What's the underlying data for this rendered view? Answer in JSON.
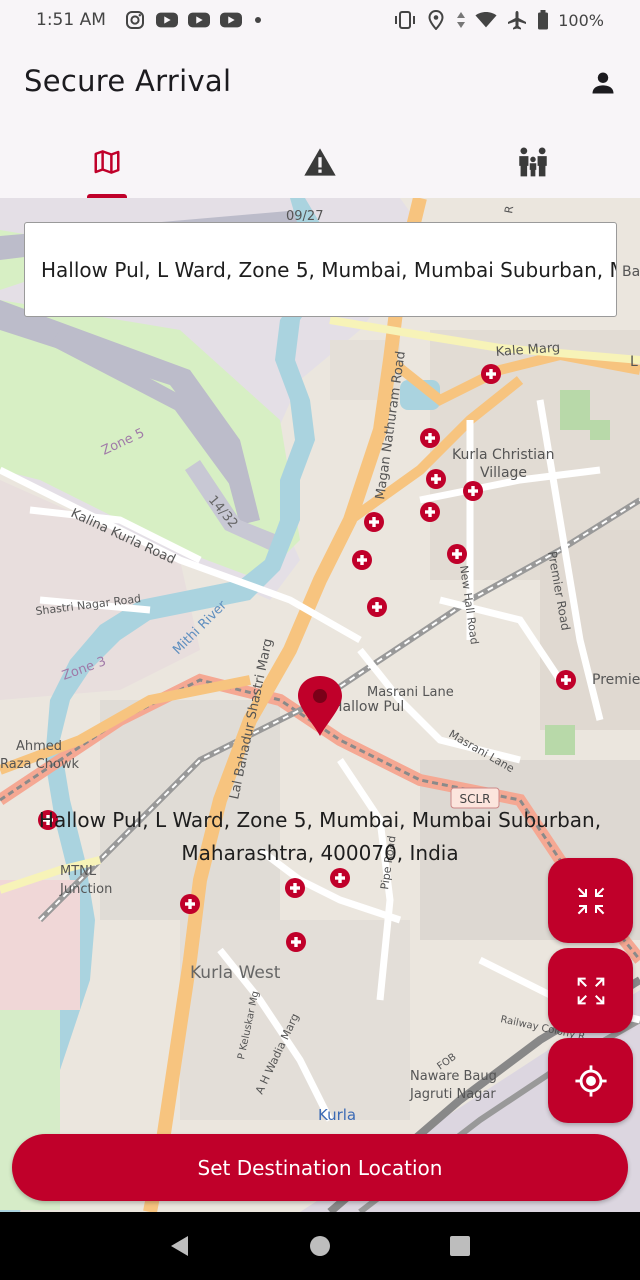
{
  "status_bar": {
    "time": "1:51 AM",
    "left_icons": [
      "instagram-icon",
      "youtube-icon",
      "youtube-icon",
      "youtube-icon",
      "dot-icon"
    ],
    "right_icons": [
      "vibrate-icon",
      "location-icon",
      "data-arrows-icon",
      "wifi-icon",
      "airplane-icon",
      "battery-icon"
    ],
    "battery": "100%"
  },
  "app_bar": {
    "title": "Secure Arrival",
    "profile_icon": "person-icon"
  },
  "tabs": [
    {
      "icon": "map-icon",
      "selected": true
    },
    {
      "icon": "warning-icon",
      "selected": false
    },
    {
      "icon": "family-icon",
      "selected": false
    }
  ],
  "search": {
    "value": "Hallow Pul, L Ward, Zone 5, Mumbai, Mumbai Suburban, Maharashtra, 400070, India"
  },
  "map": {
    "labels": {
      "road_0927": "09/27",
      "kale_marg": "Kale Marg",
      "magan_nathuram_road": "Magan Nathuram Road",
      "kurla_christian_village_1": "Kurla Christian",
      "kurla_christian_village_2": "Village",
      "zone5": "Zone 5",
      "runway_1432": "14/32",
      "kalina_kurla_road": "Kalina Kurla Road",
      "shastri_nagar_road": "Shastri Nagar Road",
      "mithi_river": "Mithi River",
      "zone3": "Zone 3",
      "new_hall_road": "New Hall Road",
      "premier_road": "Premier Road",
      "premier": "Premie",
      "masrani_lane": "Masrani Lane",
      "masrani_lane_2": "Masrani Lane",
      "hallow_pul": "Hallow Pul",
      "ahmed_raza_chowk_1": "Ahmed",
      "ahmed_raza_chowk_2": "Raza Chowk",
      "lbs_marg": "Lal Bahadur Shastri Marg",
      "sclr": "SCLR",
      "mtnl_junction_1": "MTNL",
      "mtnl_junction_2": "Junction",
      "pipe_road": "Pipe Road",
      "kurla_west": "Kurla West",
      "keluskar_marg": "P Keluskar Mg",
      "wadia_marg": "A H Wadia Marg",
      "naware_baug": "Naware Baug",
      "jagruti_nagar": "Jagruti Nagar",
      "kurla": "Kurla",
      "railway_colony": "Railway Colony R",
      "fob": "FOB",
      "ba": "Ba",
      "l": "L",
      "r": "R"
    },
    "pin_label": "Hallow Pul, L Ward, Zone 5, Mumbai, Mumbai Suburban, Maharashtra, 400070, India",
    "accent_color": "#c0002a"
  },
  "fabs": [
    {
      "name": "zoom-out-button",
      "icon": "collapse-arrows-icon"
    },
    {
      "name": "zoom-in-button",
      "icon": "expand-arrows-icon"
    },
    {
      "name": "my-location-button",
      "icon": "my-location-icon"
    }
  ],
  "cta": {
    "label": "Set Destination Location"
  },
  "nav_bar": {
    "buttons": [
      "back-icon",
      "home-icon",
      "recents-icon"
    ]
  }
}
